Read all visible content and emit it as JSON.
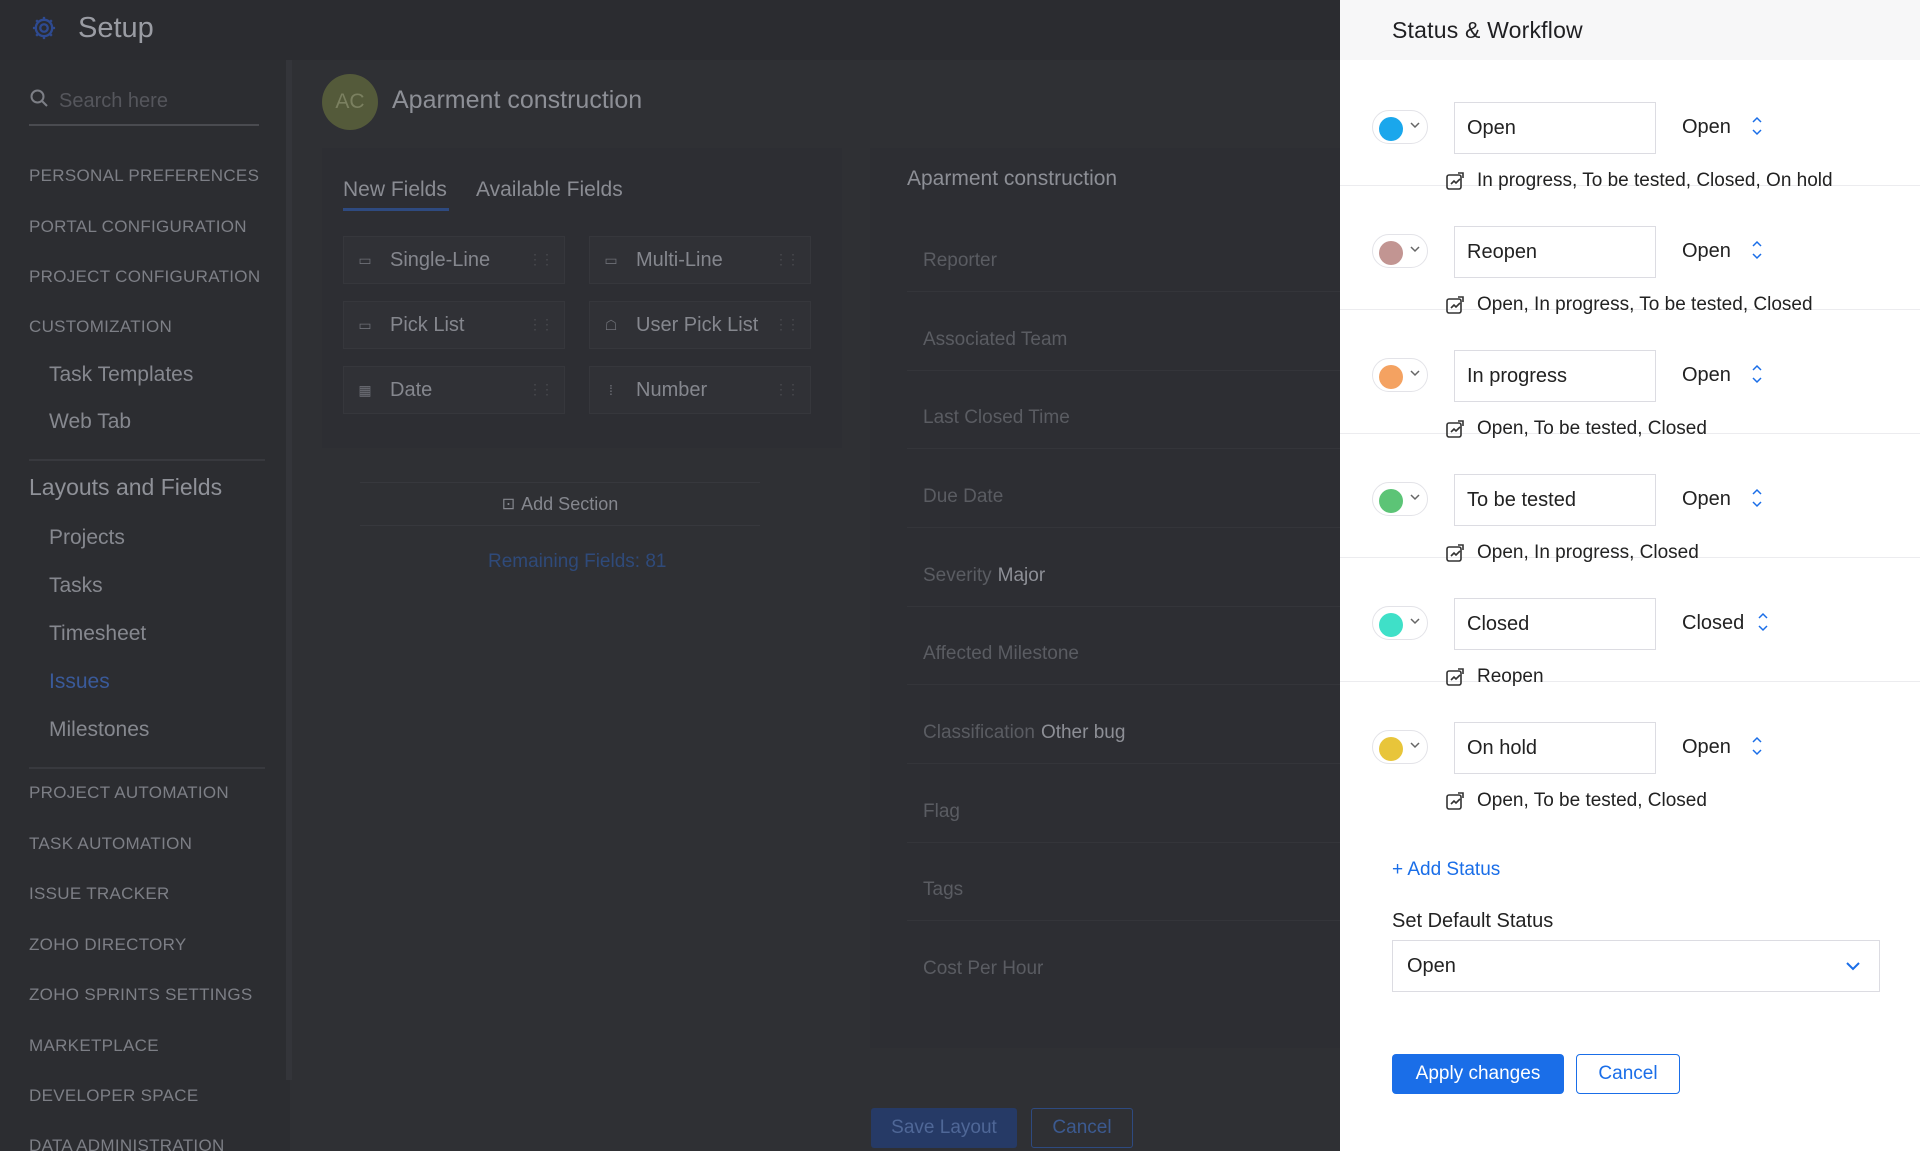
{
  "app": {
    "title": "Setup",
    "search_placeholder": "Search here"
  },
  "sidebar": {
    "sections": [
      {
        "label": "PERSONAL PREFERENCES"
      },
      {
        "label": "PORTAL CONFIGURATION"
      },
      {
        "label": "PROJECT CONFIGURATION"
      },
      {
        "label": "CUSTOMIZATION"
      },
      {
        "label": "PROJECT AUTOMATION"
      },
      {
        "label": "TASK AUTOMATION"
      },
      {
        "label": "ISSUE TRACKER"
      },
      {
        "label": "ZOHO DIRECTORY"
      },
      {
        "label": "ZOHO SPRINTS SETTINGS"
      },
      {
        "label": "MARKETPLACE"
      },
      {
        "label": "DEVELOPER SPACE"
      },
      {
        "label": "DATA ADMINISTRATION"
      }
    ],
    "customization_items": [
      {
        "label": "Task Templates"
      },
      {
        "label": "Web Tab"
      }
    ],
    "layouts_group": "Layouts and Fields",
    "layouts_items": [
      {
        "label": "Projects"
      },
      {
        "label": "Tasks"
      },
      {
        "label": "Timesheet"
      },
      {
        "label": "Issues",
        "active": true
      },
      {
        "label": "Milestones"
      }
    ]
  },
  "main": {
    "avatar_initials": "AC",
    "project_title": "Aparment construction",
    "tabs": [
      {
        "label": "New Fields",
        "active": true
      },
      {
        "label": "Available Fields"
      }
    ],
    "fields": [
      {
        "label": "Single-Line",
        "icon": "single-line-icon"
      },
      {
        "label": "Multi-Line",
        "icon": "multi-line-icon"
      },
      {
        "label": "Pick List",
        "icon": "pick-list-icon"
      },
      {
        "label": "User Pick List",
        "icon": "user-pick-list-icon"
      },
      {
        "label": "Date",
        "icon": "calendar-icon"
      },
      {
        "label": "Number",
        "icon": "number-icon"
      }
    ],
    "add_section": "Add Section",
    "remaining_fields": "Remaining Fields: 81",
    "layout_title": "Aparment construction",
    "layout_fields": [
      {
        "label": "Reporter",
        "value": ""
      },
      {
        "label": "Associated Team",
        "value": ""
      },
      {
        "label": "Last Closed Time",
        "value": ""
      },
      {
        "label": "Due Date",
        "value": ""
      },
      {
        "label": "Severity",
        "value": "Major"
      },
      {
        "label": "Affected Milestone",
        "value": ""
      },
      {
        "label": "Classification",
        "value": "Other bug"
      },
      {
        "label": "Flag",
        "value": ""
      },
      {
        "label": "Tags",
        "value": ""
      },
      {
        "label": "Cost Per Hour",
        "value": ""
      }
    ],
    "save_label": "Save Layout",
    "cancel_label": "Cancel"
  },
  "drawer": {
    "title": "Status & Workflow",
    "statuses": [
      {
        "name": "Open",
        "type": "Open",
        "color": "#1aa7ec",
        "transitions": "In progress, To be tested, Closed, On hold"
      },
      {
        "name": "Reopen",
        "type": "Open",
        "color": "#c29592",
        "transitions": "Open, In progress, To be tested, Closed"
      },
      {
        "name": "In progress",
        "type": "Open",
        "color": "#f4a261",
        "transitions": "Open, To be tested, Closed"
      },
      {
        "name": "To be tested",
        "type": "Open",
        "color": "#5cc476",
        "transitions": "Open, In progress, Closed"
      },
      {
        "name": "Closed",
        "type": "Closed",
        "color": "#3fe0c8",
        "transitions": "Reopen"
      },
      {
        "name": "On hold",
        "type": "Open",
        "color": "#e8c53a",
        "transitions": "Open, To be tested, Closed"
      }
    ],
    "add_status": "+ Add Status",
    "default_label": "Set Default Status",
    "default_value": "Open",
    "apply_label": "Apply changes",
    "cancel_label": "Cancel"
  },
  "colors": {
    "accent": "#1a6ee8",
    "overlay": "#2f3034"
  }
}
